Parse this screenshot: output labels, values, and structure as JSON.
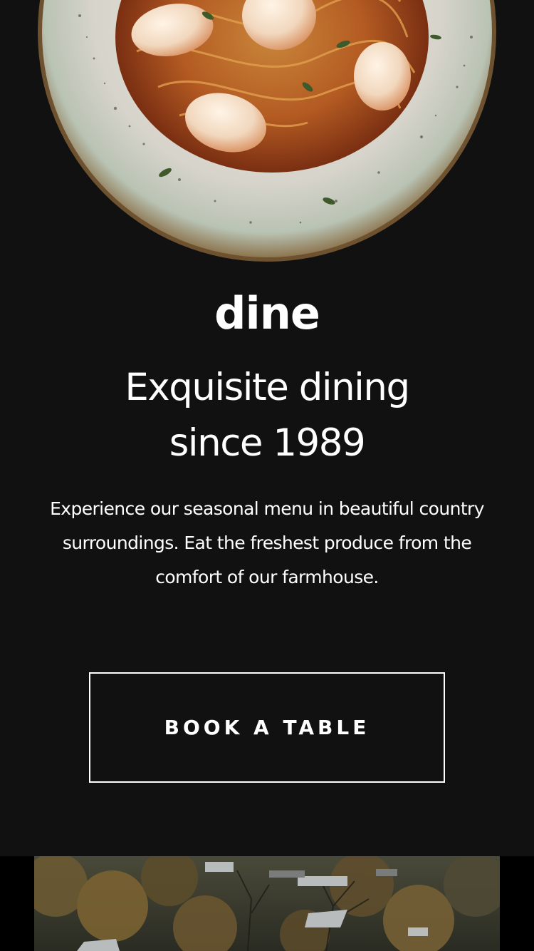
{
  "hero": {
    "logo": "dine",
    "headline_line1": "Exquisite dining",
    "headline_line2": "since 1989",
    "intro_line1": "Experience our seasonal menu in beautiful country",
    "intro_line2": "surroundings. Eat the freshest produce from the",
    "intro_line3": "comfort of our farmhouse.",
    "cta_label": "BOOK A TABLE"
  },
  "colors": {
    "background": "#111111",
    "text": "#ffffff",
    "section_background": "#000000"
  },
  "images": {
    "hero_image": "pasta-shrimp-plate",
    "section_image": "farmhouse-aerial-trees"
  }
}
